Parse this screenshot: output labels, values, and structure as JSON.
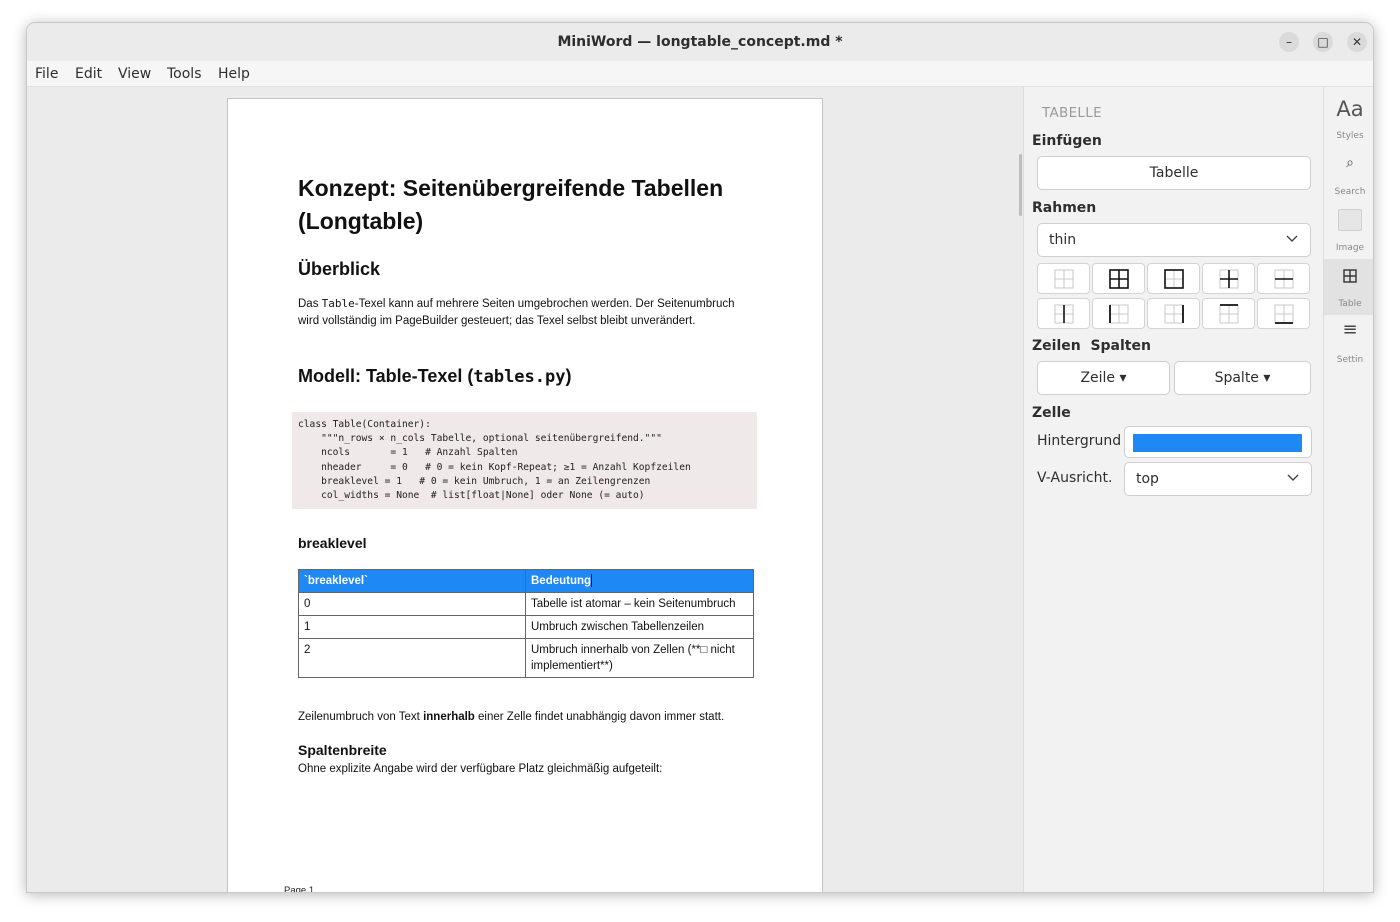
{
  "window": {
    "title": "MiniWord — longtable_concept.md *",
    "controls": {
      "minimize": "–",
      "maximize": "□",
      "close": "✕"
    }
  },
  "menubar": {
    "items": [
      "File",
      "Edit",
      "View",
      "Tools",
      "Help"
    ]
  },
  "document": {
    "title": "Konzept: Seitenübergreifende Tabellen (Longtable)",
    "overview_heading": "Überblick",
    "overview_text": {
      "before_code": "Das ",
      "code": "Table",
      "after_code": "-Texel kann auf mehrere Seiten umgebrochen werden. Der Seitenumbruch wird vollständig im PageBuilder gesteuert; das Texel selbst bleibt unverändert."
    },
    "model_heading": {
      "text": "Modell: Table-Texel (",
      "code": "tables.py",
      "close": ")"
    },
    "code_lines": [
      "class Table(Container):",
      "    \"\"\"n_rows × n_cols Tabelle, optional seitenübergreifend.\"\"\"",
      "    ncols       = 1   # Anzahl Spalten",
      "    nheader     = 0   # 0 = kein Kopf-Repeat; ≥1 = Anzahl Kopfzeilen",
      "    breaklevel = 1   # 0 = kein Umbruch, 1 = an Zeilengrenzen",
      "    col_widths = None  # list[float|None] oder None (= auto)"
    ],
    "breaklevel_heading": "breaklevel",
    "table": {
      "header": [
        "`breaklevel`",
        "Bedeutung"
      ],
      "rows": [
        [
          "0",
          "Tabelle ist atomar – kein Seitenumbruch"
        ],
        [
          "1",
          "Umbruch zwischen Tabellenzeilen"
        ],
        [
          "2",
          "Umbruch innerhalb von Zellen (**□ nicht implementiert**)"
        ]
      ]
    },
    "wrap_text": {
      "before": "Zeilenumbruch von Text ",
      "bold": "innerhalb",
      "after": " einer Zelle findet unabhängig davon immer statt."
    },
    "colwidth_heading": "Spaltenbreite",
    "colwidth_text": "Ohne explizite Angabe wird der verfügbare Platz gleichmäßig aufgeteilt:",
    "page_number": "Page 1"
  },
  "panel": {
    "title": "TABELLE",
    "insert_section": "Einfügen",
    "insert_button": "Tabelle",
    "border_section": "Rahmen",
    "border_value": "thin",
    "rows_cols_section": "Zeilen  Spalten",
    "row_button": "Zeile ▾",
    "col_button": "Spalte ▾",
    "cell_section": "Zelle",
    "background_label": "Hintergrund",
    "background_color": "#1e88f5",
    "valign_label": "V-Ausricht.",
    "valign_value": "top"
  },
  "sidebar": {
    "items": [
      {
        "icon": "Aa",
        "label": "Styles"
      },
      {
        "icon": "⌕",
        "label": "Search"
      },
      {
        "icon": "",
        "label": "Image"
      },
      {
        "icon": "",
        "label": "Table"
      },
      {
        "icon": "≡",
        "label": "Settin"
      }
    ]
  },
  "colors": {
    "accent": "#1e88f5",
    "code_bg": "#efe9e9"
  }
}
